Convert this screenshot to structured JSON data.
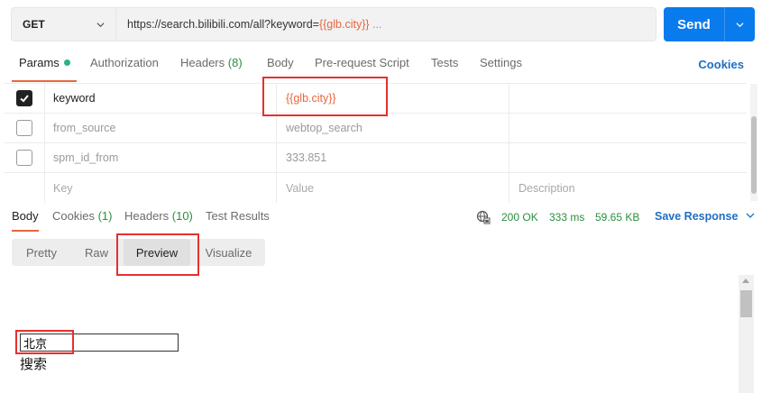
{
  "request": {
    "method": "GET",
    "url_base": "https://search.bilibili.com/all?keyword=",
    "url_var": "{{glb.city}}",
    "url_ellipsis": " ...",
    "send_label": "Send"
  },
  "request_tabs": [
    {
      "label": "Params",
      "active": true,
      "indicator": "green-dot"
    },
    {
      "label": "Authorization"
    },
    {
      "label": "Headers",
      "count": "(8)"
    },
    {
      "label": "Body"
    },
    {
      "label": "Pre-request Script"
    },
    {
      "label": "Tests"
    },
    {
      "label": "Settings"
    }
  ],
  "cookies_link": "Cookies",
  "params": {
    "rows": [
      {
        "checked": true,
        "key": "keyword",
        "value": "{{glb.city}}",
        "description": ""
      },
      {
        "checked": false,
        "key": "from_source",
        "value": "webtop_search",
        "description": ""
      },
      {
        "checked": false,
        "key": "spm_id_from",
        "value": "333.851",
        "description": ""
      }
    ],
    "placeholder": {
      "key": "Key",
      "value": "Value",
      "description": "Description"
    }
  },
  "response_tabs": [
    {
      "label": "Body",
      "active": true
    },
    {
      "label": "Cookies",
      "count": "(1)"
    },
    {
      "label": "Headers",
      "count": "(10)"
    },
    {
      "label": "Test Results"
    }
  ],
  "response_meta": {
    "status": "200 OK",
    "time": "333 ms",
    "size": "59.65 KB",
    "save_label": "Save Response"
  },
  "view_modes": [
    {
      "label": "Pretty"
    },
    {
      "label": "Raw"
    },
    {
      "label": "Preview",
      "active": true
    },
    {
      "label": "Visualize"
    }
  ],
  "preview": {
    "input_value": "北京",
    "search_text": "搜索"
  },
  "colors": {
    "accent": "#e8663d",
    "send_blue": "#097bed",
    "link_blue": "#1f6ec2",
    "status_green": "#2a8e3e",
    "annotation_red": "#e5302f"
  }
}
